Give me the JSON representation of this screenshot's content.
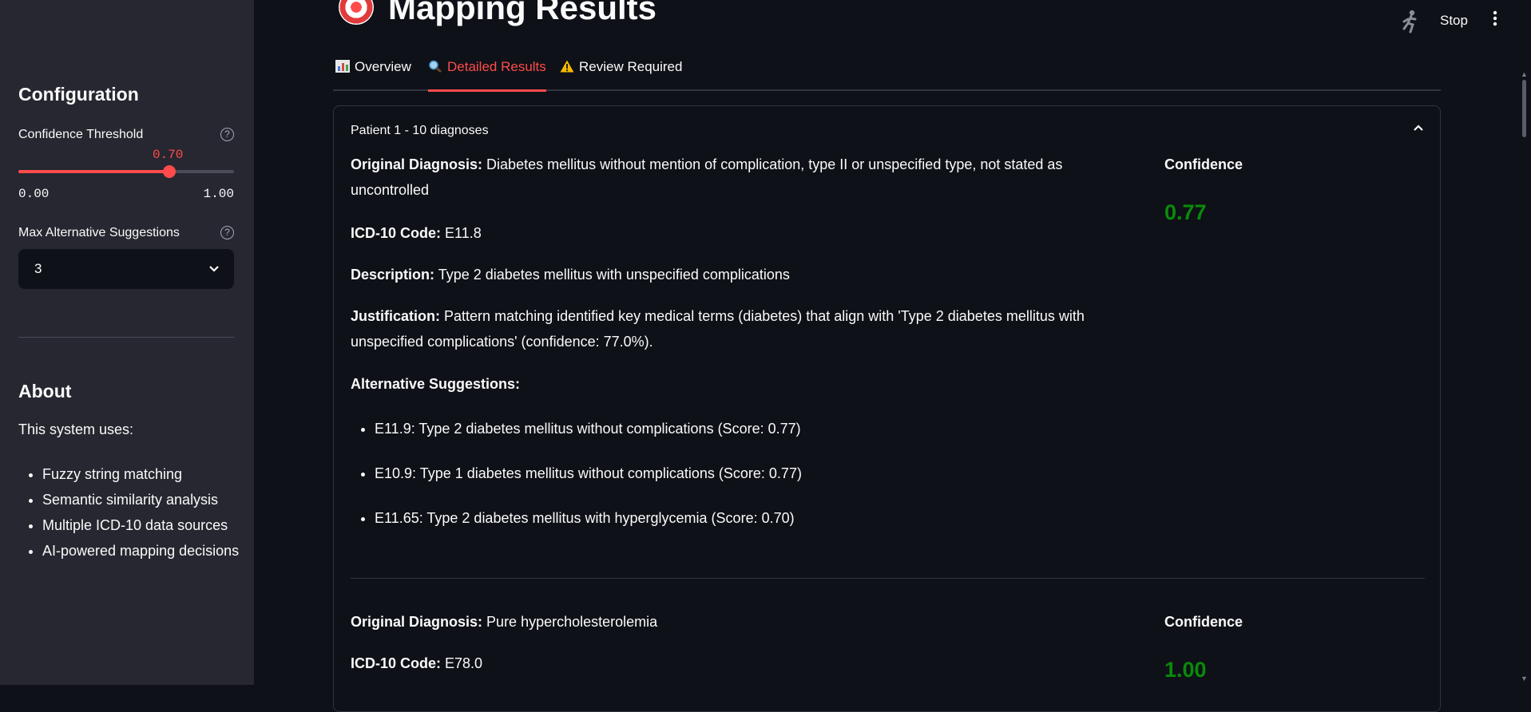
{
  "sidebar": {
    "config_title": "Configuration",
    "confidence_label": "Confidence Threshold",
    "confidence_value": "0.70",
    "confidence_fraction": 0.7,
    "slider_min": "0.00",
    "slider_max": "1.00",
    "max_alt_label": "Max Alternative Suggestions",
    "max_alt_value": "3",
    "about_title": "About",
    "about_text": "This system uses:",
    "about_items": [
      "Fuzzy string matching",
      "Semantic similarity analysis",
      "Multiple ICD-10 data sources",
      "AI-powered mapping decisions"
    ]
  },
  "header": {
    "title": "Mapping Results",
    "title_icon": "target-icon",
    "stop_label": "Stop"
  },
  "tabs": [
    {
      "label": "Overview",
      "icon": "bar-chart-icon"
    },
    {
      "label": "Detailed Results",
      "icon": "magnifier-icon"
    },
    {
      "label": "Review Required",
      "icon": "warning-icon"
    }
  ],
  "expander": {
    "title": "Patient 1 - 10 diagnoses"
  },
  "labels": {
    "original": "Original Diagnosis:",
    "icd": "ICD-10 Code:",
    "description": "Description:",
    "justification": "Justification:",
    "alternatives": "Alternative Suggestions:",
    "confidence": "Confidence"
  },
  "results": [
    {
      "original": "Diabetes mellitus without mention of complication, type II or unspecified type, not stated as uncontrolled",
      "code": "E11.8",
      "description": "Type 2 diabetes mellitus with unspecified complications",
      "justification": "Pattern matching identified key medical terms (diabetes) that align with 'Type 2 diabetes mellitus with unspecified complications' (confidence: 77.0%).",
      "confidence": "0.77",
      "alternatives": [
        "E11.9: Type 2 diabetes mellitus without complications (Score: 0.77)",
        "E10.9: Type 1 diabetes mellitus without complications (Score: 0.77)",
        "E11.65: Type 2 diabetes mellitus with hyperglycemia (Score: 0.70)"
      ]
    },
    {
      "original": "Pure hypercholesterolemia",
      "code": "E78.0",
      "confidence": "1.00"
    }
  ],
  "colors": {
    "accent": "#ff4b4b",
    "confidence_good": "#0a8a0a",
    "sidebar_bg": "#262730",
    "main_bg": "#0e1117"
  }
}
